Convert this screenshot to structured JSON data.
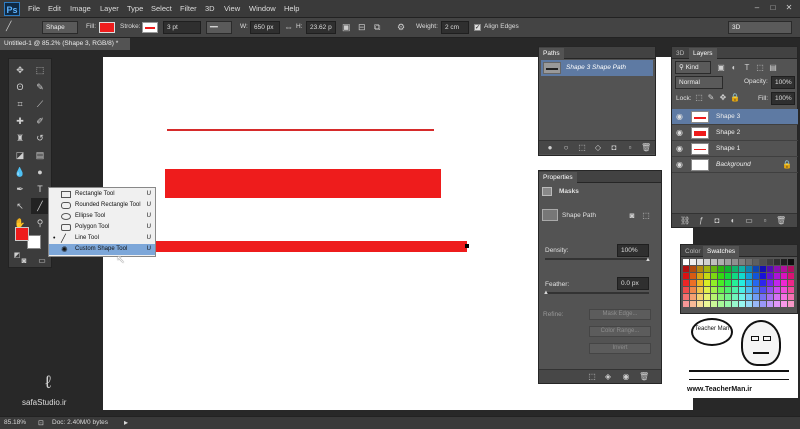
{
  "app": {
    "logo": "Ps",
    "menu": [
      "File",
      "Edit",
      "Image",
      "Layer",
      "Type",
      "Select",
      "Filter",
      "3D",
      "View",
      "Window",
      "Help"
    ]
  },
  "options": {
    "mode": "Shape",
    "fill_label": "Fill:",
    "stroke_label": "Stroke:",
    "stroke_width": "3 pt",
    "w_label": "W:",
    "w_value": "650 px",
    "h_label": "H:",
    "h_value": "23.62 p",
    "weight_label": "Weight:",
    "weight_value": "2 cm",
    "align_edges": "Align Edges",
    "workspace": "3D",
    "fill_color": "#ee1c1c"
  },
  "document": {
    "tab_title": "Untitled-1 @ 85.2% (Shape 3, RGB/8) *"
  },
  "flyout": {
    "items": [
      {
        "label": "Rectangle Tool",
        "key": "U"
      },
      {
        "label": "Rounded Rectangle Tool",
        "key": "U"
      },
      {
        "label": "Ellipse Tool",
        "key": "U"
      },
      {
        "label": "Polygon Tool",
        "key": "U"
      },
      {
        "label": "Line Tool",
        "key": "U"
      },
      {
        "label": "Custom Shape Tool",
        "key": "U"
      }
    ]
  },
  "paths_panel": {
    "tab": "Paths",
    "item": "Shape 3 Shape Path"
  },
  "properties_panel": {
    "tab": "Properties",
    "section": "Masks",
    "shape_path": "Shape Path",
    "density_label": "Density:",
    "density_value": "100%",
    "feather_label": "Feather:",
    "feather_value": "0.0 px",
    "refine_label": "Refine:",
    "mask_edge": "Mask Edge...",
    "color_range": "Color Range...",
    "invert": "Invert"
  },
  "layers_panel": {
    "tab_3d": "3D",
    "tab_layers": "Layers",
    "kind": "Kind",
    "blend": "Normal",
    "opacity_label": "Opacity:",
    "opacity_value": "100%",
    "lock_label": "Lock:",
    "fill_label": "Fill:",
    "fill_value": "100%",
    "layers": [
      "Shape 3",
      "Shape 2",
      "Shape 1",
      "Background"
    ]
  },
  "swatches_panel": {
    "tab_color": "Color",
    "tab_swatches": "Swatches"
  },
  "watermark": {
    "site": "www.TeacherMan.ir",
    "studio": "safaStudio.ir",
    "brand": "Teacher Man"
  },
  "status": {
    "zoom": "85.18%",
    "doc": "Doc: 2.40M/0 bytes"
  },
  "colors": {
    "accent_red": "#ee1c1c",
    "selection_blue": "#5e7aa3"
  }
}
